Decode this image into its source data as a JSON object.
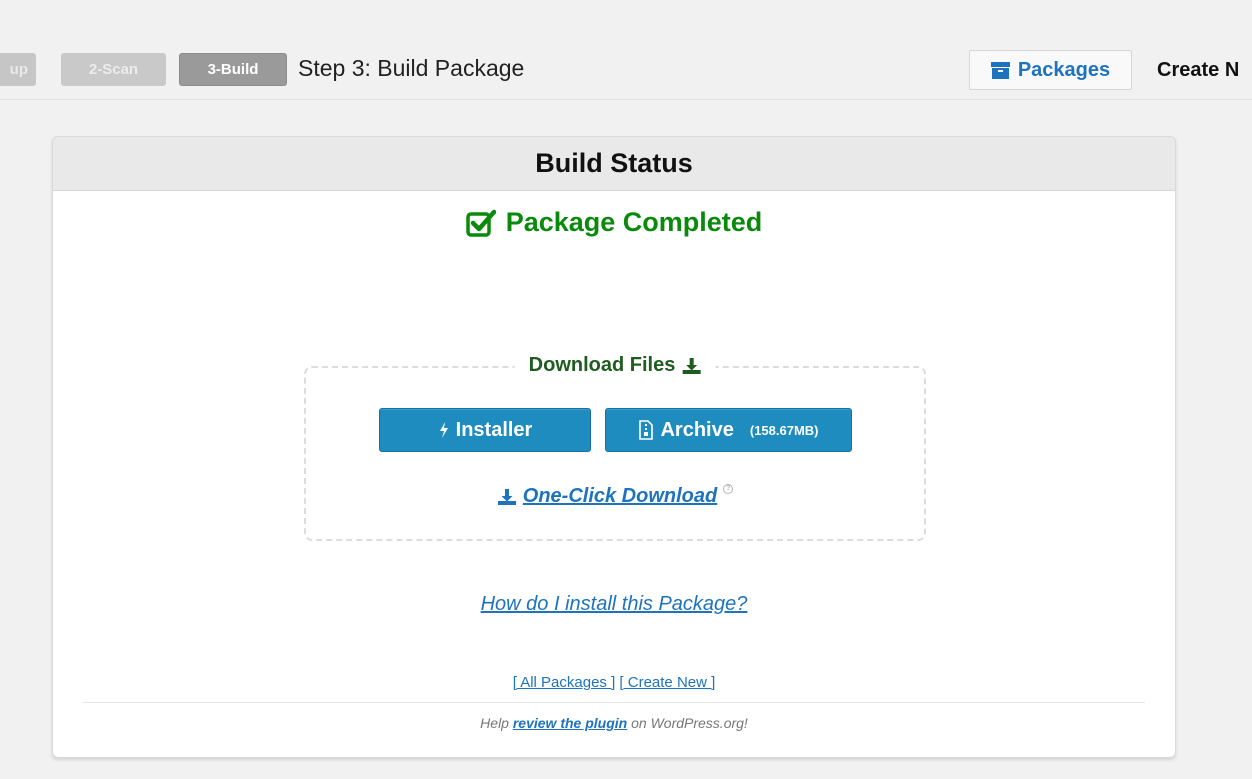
{
  "steps": {
    "step1_label": "up",
    "step2_label": "2-Scan",
    "step3_label": "3-Build",
    "title": "Step 3: Build Package"
  },
  "header_actions": {
    "packages_label": "Packages",
    "create_new_label": "Create N"
  },
  "panel": {
    "title": "Build Status",
    "status": "Package Completed",
    "download": {
      "legend": "Download Files",
      "installer_label": "Installer",
      "archive_label": "Archive",
      "archive_size": "(158.67MB)",
      "one_click_label": "One-Click Download"
    },
    "how_to_link": "How do I install this Package?",
    "links": {
      "all_packages": "[ All Packages ]",
      "create_new": "[ Create New ]"
    },
    "footer": {
      "prefix": "Help",
      "link": "review the plugin",
      "suffix": "on WordPress.org!"
    }
  },
  "colors": {
    "accent": "#1e73be",
    "button_blue": "#1e8cbe",
    "success_green": "#0a8a0a",
    "legend_green": "#1f5c1f"
  }
}
